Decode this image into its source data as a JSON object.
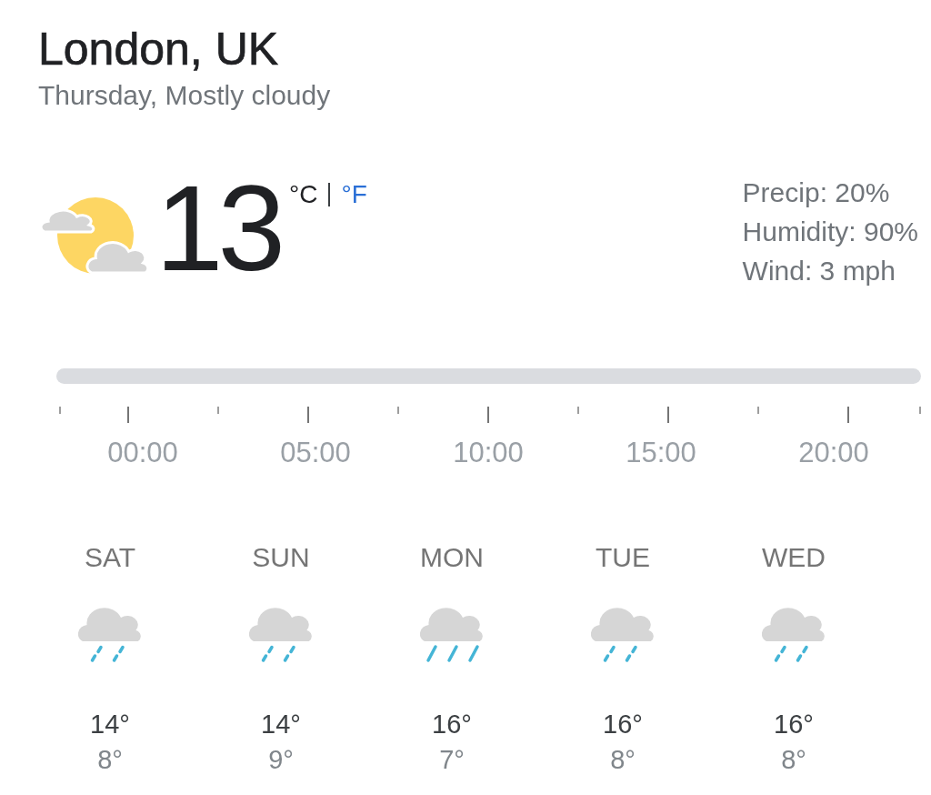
{
  "location": {
    "title": "London, UK",
    "subtitle": "Thursday, Mostly cloudy"
  },
  "current": {
    "temperature": "13",
    "units": [
      {
        "label": "°C",
        "selected": true
      },
      {
        "label": "°F",
        "selected": false
      }
    ],
    "details": [
      "Precip: 20%",
      "Humidity: 90%",
      "Wind: 3 mph"
    ]
  },
  "timeline": {
    "hours": [
      "00:00",
      "05:00",
      "10:00",
      "15:00",
      "20:00"
    ]
  },
  "forecast": [
    {
      "day": "SAT",
      "kind": "light_rain",
      "high": "14°",
      "low": "8°"
    },
    {
      "day": "SUN",
      "kind": "light_rain",
      "high": "14°",
      "low": "9°"
    },
    {
      "day": "MON",
      "kind": "rain",
      "high": "16°",
      "low": "7°"
    },
    {
      "day": "TUE",
      "kind": "light_rain",
      "high": "16°",
      "low": "8°"
    },
    {
      "day": "WED",
      "kind": "light_rain",
      "high": "16°",
      "low": "8°"
    }
  ]
}
